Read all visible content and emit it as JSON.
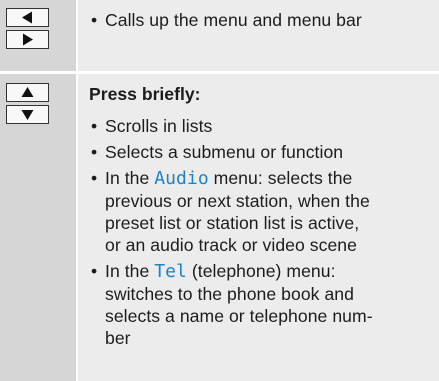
{
  "rows": [
    {
      "keys": [
        "left-arrow",
        "right-arrow"
      ],
      "bullets": [
        {
          "text": "Calls up the menu and menu bar"
        }
      ]
    },
    {
      "keys": [
        "up-arrow",
        "down-arrow"
      ],
      "heading": "Press briefly:",
      "bullets": [
        {
          "text": "Scrolls in lists"
        },
        {
          "text": "Selects a submenu or function"
        },
        {
          "prefix": "In the ",
          "keyword": "Audio",
          "line1_rest": " menu: selects the",
          "line2": "previous or next station, when the",
          "line3": "preset list or station list is active,",
          "line4": "or an audio track or video scene"
        },
        {
          "prefix": "In the ",
          "keyword": "Tel",
          "line1_rest": " (telephone) menu:",
          "line2": "switches to the phone book and",
          "line3": "selects a name or telephone num-",
          "line4": "ber"
        }
      ]
    }
  ],
  "colors": {
    "row_bg": "#ececec",
    "key_column_bg": "#d6d6d6",
    "keyword": "#1e82c8",
    "text": "#1c1c1c"
  }
}
